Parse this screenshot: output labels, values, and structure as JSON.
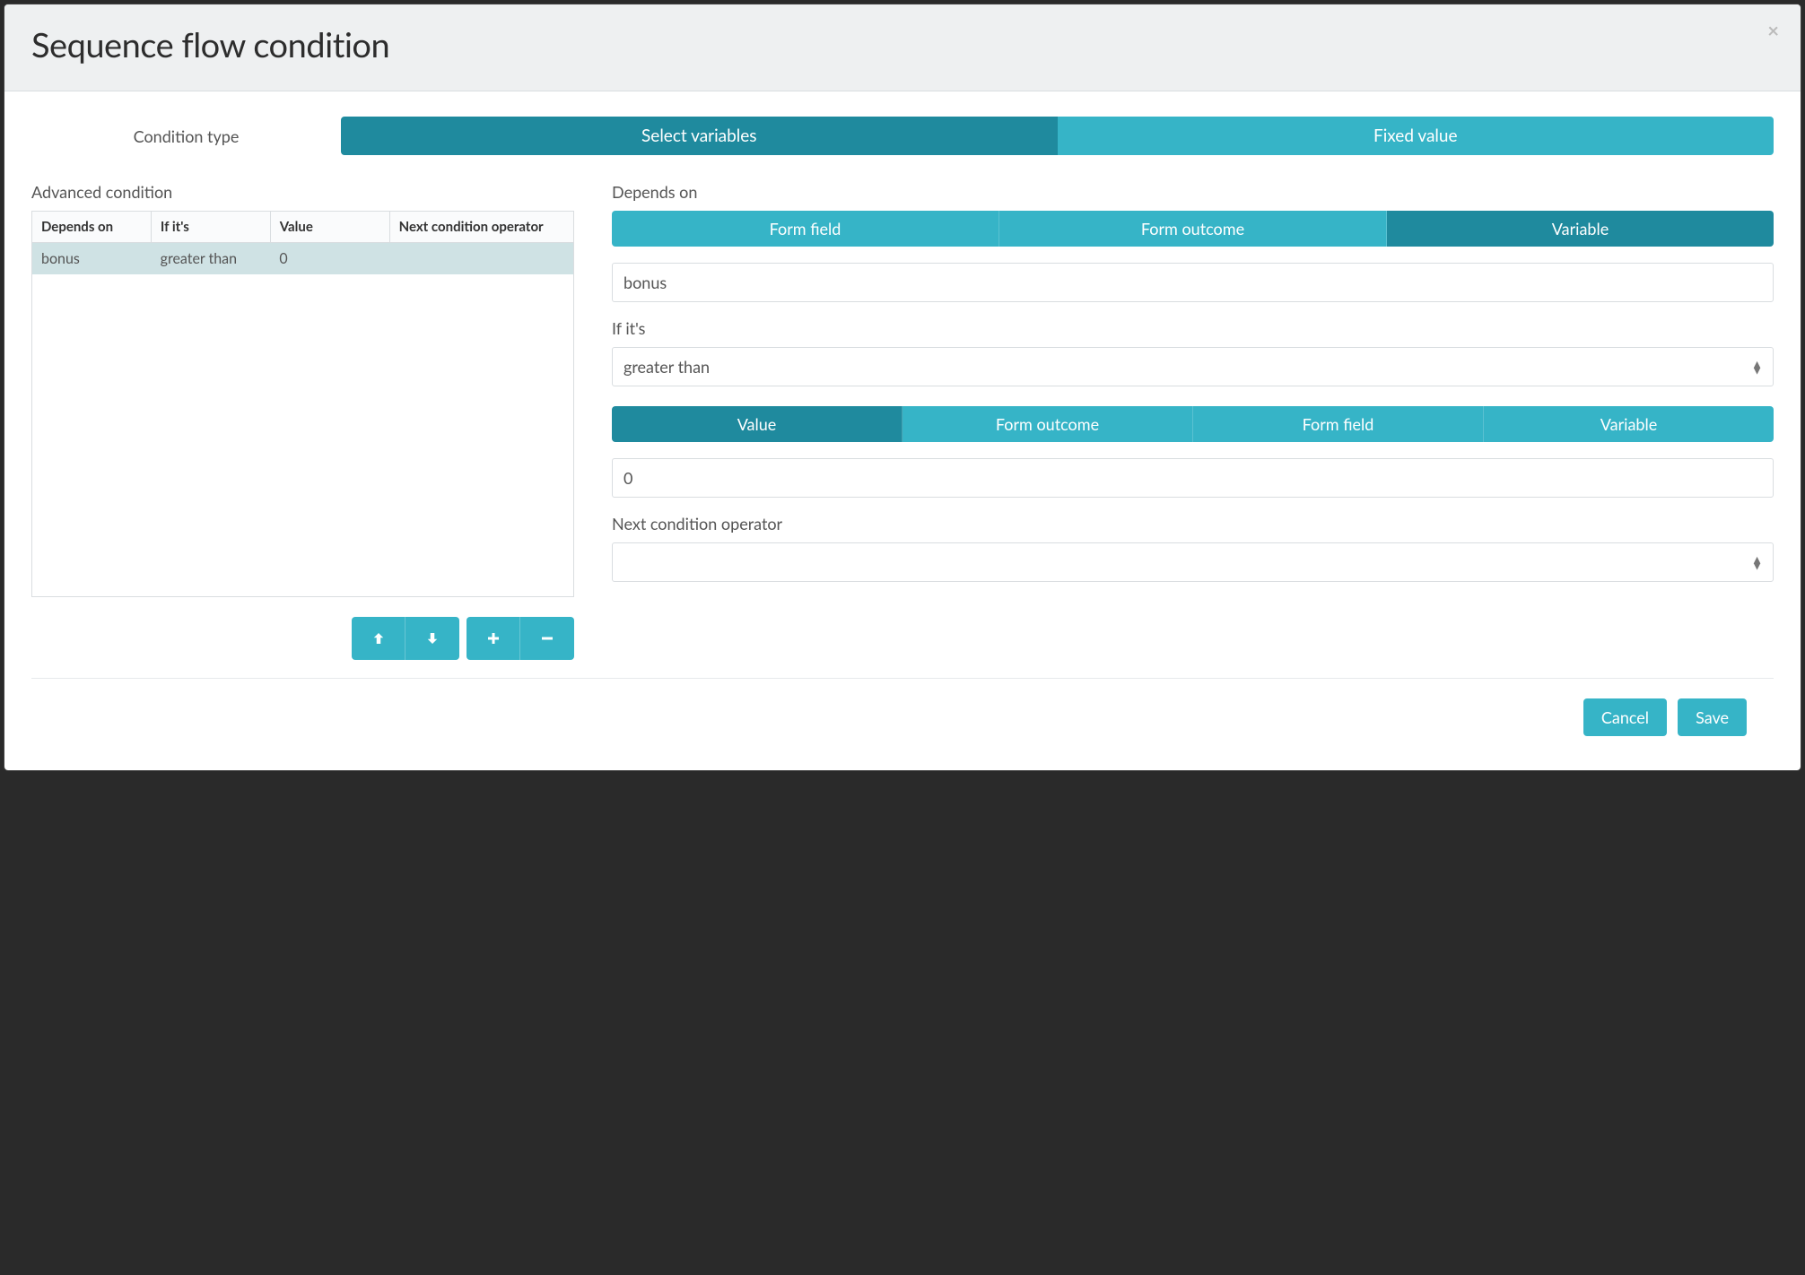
{
  "modal": {
    "title": "Sequence flow condition",
    "close_label": "×"
  },
  "condition_type": {
    "label": "Condition type",
    "tabs": {
      "select_variables": "Select variables",
      "fixed_value": "Fixed value",
      "active": "select_variables"
    }
  },
  "advanced": {
    "label": "Advanced condition",
    "columns": {
      "depends_on": "Depends on",
      "if_its": "If it's",
      "value": "Value",
      "next_operator": "Next condition operator"
    },
    "rows": [
      {
        "depends_on": "bonus",
        "if_its": "greater than",
        "value": "0",
        "next_operator": "",
        "selected": true
      }
    ]
  },
  "detail": {
    "depends_on": {
      "label": "Depends on",
      "options": {
        "form_field": "Form field",
        "form_outcome": "Form outcome",
        "variable": "Variable",
        "active": "variable"
      },
      "value": "bonus"
    },
    "if_its": {
      "label": "If it's",
      "selected": "greater than"
    },
    "value_source": {
      "options": {
        "value": "Value",
        "form_outcome": "Form outcome",
        "form_field": "Form field",
        "variable": "Variable",
        "active": "value"
      },
      "value": "0"
    },
    "next_operator": {
      "label": "Next condition operator",
      "selected": ""
    }
  },
  "footer": {
    "cancel": "Cancel",
    "save": "Save"
  },
  "icons": {
    "move_up": "arrow-up-icon",
    "move_down": "arrow-down-icon",
    "add": "plus-icon",
    "remove": "minus-icon"
  }
}
